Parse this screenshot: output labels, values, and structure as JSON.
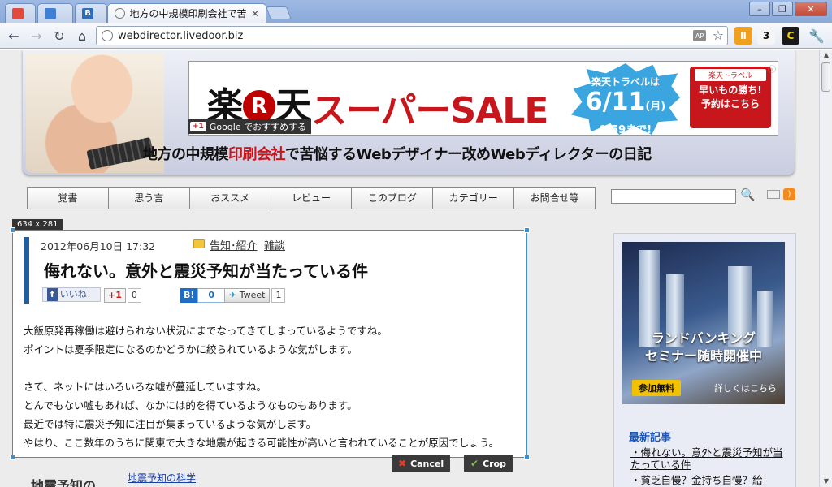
{
  "browser": {
    "tabs": [
      {
        "label": ""
      },
      {
        "label": ""
      },
      {
        "label": "B"
      },
      {
        "label": "地方の中規模印刷会社で苦悩するWebデザイナー改めWebディレクターの日記"
      }
    ],
    "address": "webdirector.livedoor.biz",
    "window_buttons": [
      "–",
      "❐",
      "✕"
    ],
    "ext_counter": "3"
  },
  "ad": {
    "logo_left": "楽",
    "logo_r": "R",
    "logo_right": "天",
    "sale": "スーパーSALE",
    "burst_line1": "楽天トラベルは",
    "burst_line2": "6/11",
    "burst_line2_suffix": "(月)",
    "burst_line3": "9:59まで!",
    "box_logo": "楽天トラベル",
    "box_line1": "早いもの勝ち!",
    "box_line2": "予約はこちら",
    "info": "ⓘ",
    "gplus_label": "+1",
    "gplus_text": "Google でおすすめする"
  },
  "header": {
    "title_pre": "地方の中規模",
    "title_hl": "印刷会社",
    "title_post": "で苦悩するWebデザイナー改めWebディレクターの日記"
  },
  "nav": [
    "覚書",
    "思う言",
    "おススメ",
    "レビュー",
    "このブログ",
    "カテゴリー",
    "お問合せ等"
  ],
  "crop": {
    "size_label": "634 x 281",
    "cancel_label": "Cancel",
    "crop_label": "Crop"
  },
  "post": {
    "date": "2012年06月10日 17:32",
    "categories": [
      "告知･紹介",
      "雑談"
    ],
    "title": "侮れない。意外と震災予知が当たっている件",
    "fb_label": "いいね！",
    "gplus_label": "+1",
    "gplus_count": "0",
    "hatena_label": "B!",
    "hatena_count": "0",
    "tweet_label": "Tweet",
    "tweet_count": "1",
    "paragraphs": [
      "大飯原発再稼働は避けられない状況にまでなってきてしまっているようですね。",
      "ポイントは夏季限定になるのかどうかに絞られているような気がします。",
      "",
      "さて、ネットにはいろいろな嘘が蔓延していますね。",
      "とんでもない嘘もあれば、なかには的を得ているようなものもあります。",
      "最近では特に震災予知に注目が集まっているような気がします。",
      "やはり、ここ数年のうちに関東で大きな地震が起きる可能性が高いと言われていることが原因でしょう。"
    ]
  },
  "below": {
    "heading": "地震予知の",
    "link": "地震予知の科学"
  },
  "sidebar": {
    "ad_line1": "ランドバンキング",
    "ad_line2": "セミナー随時開催中",
    "ad_btn": "参加無料",
    "ad_more": "詳しくはこちら",
    "recent_heading": "最新記事",
    "recent": [
      "侮れない。意外と震災予知が当たっている件",
      "貧乏自慢？金持ち自慢？給"
    ]
  }
}
